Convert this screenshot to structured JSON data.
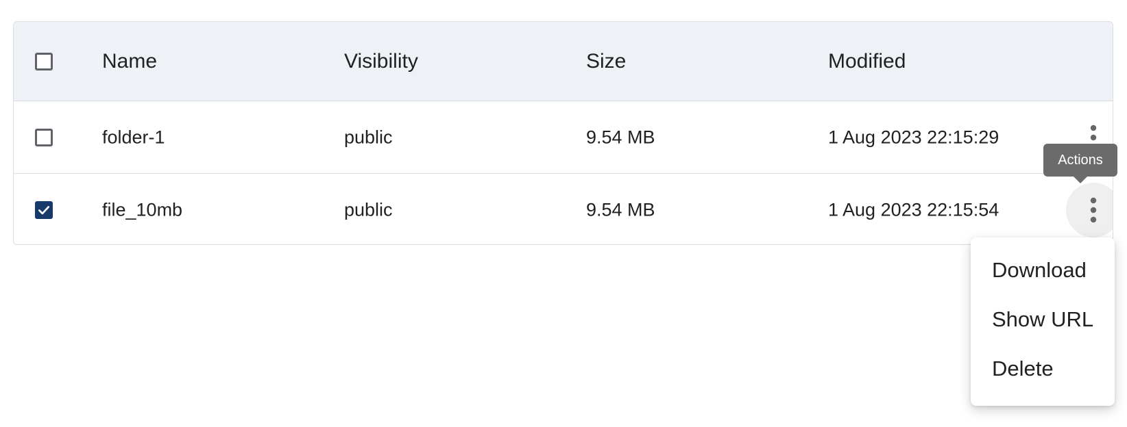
{
  "table": {
    "headers": {
      "name": "Name",
      "visibility": "Visibility",
      "size": "Size",
      "modified": "Modified"
    },
    "rows": [
      {
        "name": "folder-1",
        "name_is_link": true,
        "visibility": "public",
        "size": "9.54 MB",
        "modified": "1 Aug 2023 22:15:29",
        "checked": false
      },
      {
        "name": "file_10mb",
        "name_is_link": false,
        "visibility": "public",
        "size": "9.54 MB",
        "modified": "1 Aug 2023 22:15:54",
        "checked": true
      }
    ]
  },
  "tooltip": {
    "text": "Actions"
  },
  "actions_menu": {
    "items": [
      "Download",
      "Show URL",
      "Delete"
    ]
  },
  "icons": {
    "row_actions": "more-vertical-icon",
    "checkmark": "check-icon"
  },
  "colors": {
    "header_bg": "#eef2f6",
    "link": "#2a6c9a",
    "checkbox_checked": "#173a6b",
    "tooltip_bg": "#6b6b6b"
  }
}
